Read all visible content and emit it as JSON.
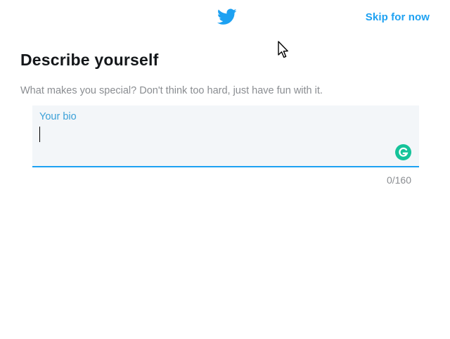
{
  "header": {
    "logo_icon": "twitter-bird-icon",
    "brand_color": "#1da1f2",
    "skip_label": "Skip for now"
  },
  "main": {
    "title": "Describe yourself",
    "subtitle": "What makes you special? Don't think too hard, just have fun with it.",
    "bio": {
      "label": "Your bio",
      "value": "",
      "counter": "0/160",
      "accent_color": "#1da1f2"
    },
    "grammarly": {
      "icon": "grammarly-icon",
      "color": "#15c39a"
    }
  },
  "pointer": {
    "icon": "mouse-pointer-icon"
  }
}
